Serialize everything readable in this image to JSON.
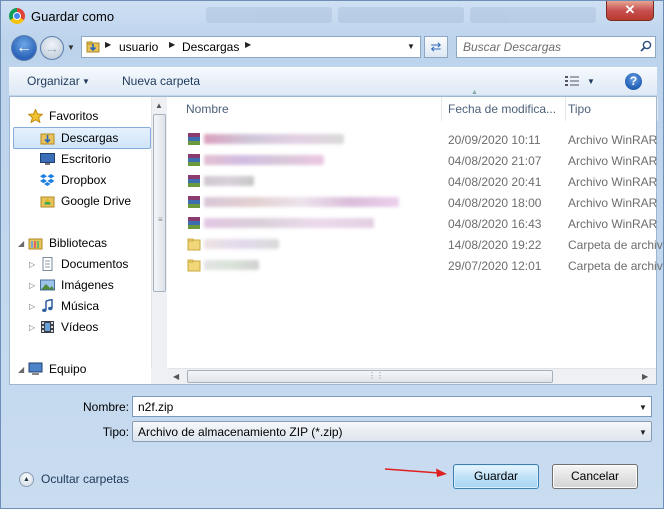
{
  "window": {
    "title": "Guardar como",
    "close_glyph": "✕"
  },
  "address_bar": {
    "crumbs": [
      "usuario",
      "Descargas"
    ],
    "search_placeholder": "Buscar Descargas"
  },
  "toolbar": {
    "organize_label": "Organizar",
    "new_folder_label": "Nueva carpeta",
    "help_glyph": "?"
  },
  "nav_pane": {
    "favorites": {
      "header": "Favoritos",
      "items": [
        {
          "label": "Descargas",
          "icon": "downloads-folder-icon",
          "selected": true
        },
        {
          "label": "Escritorio",
          "icon": "desktop-icon"
        },
        {
          "label": "Dropbox",
          "icon": "dropbox-icon"
        },
        {
          "label": "Google Drive",
          "icon": "google-drive-icon"
        }
      ]
    },
    "libraries": {
      "header": "Bibliotecas",
      "items": [
        {
          "label": "Documentos",
          "icon": "documents-icon"
        },
        {
          "label": "Imágenes",
          "icon": "pictures-icon"
        },
        {
          "label": "Música",
          "icon": "music-icon"
        },
        {
          "label": "Vídeos",
          "icon": "videos-icon"
        }
      ]
    },
    "computer": {
      "header": "Equipo"
    }
  },
  "file_list": {
    "columns": [
      "Nombre",
      "Fecha de modifica...",
      "Tipo"
    ],
    "rows": [
      {
        "name_redacted": true,
        "date": "20/09/2020 10:11",
        "type": "Archivo WinRAR",
        "icon": "winrar-archive-icon"
      },
      {
        "name_redacted": true,
        "date": "04/08/2020 21:07",
        "type": "Archivo WinRAR",
        "icon": "winrar-archive-icon"
      },
      {
        "name_redacted": true,
        "date": "04/08/2020 20:41",
        "type": "Archivo WinRAR",
        "icon": "winrar-archive-icon"
      },
      {
        "name_redacted": true,
        "date": "04/08/2020 18:00",
        "type": "Archivo WinRAR",
        "icon": "winrar-archive-icon"
      },
      {
        "name_redacted": true,
        "date": "04/08/2020 16:43",
        "type": "Archivo WinRAR",
        "icon": "winrar-archive-icon"
      },
      {
        "name_redacted": true,
        "date": "14/08/2020 19:22",
        "type": "Carpeta de archiv",
        "icon": "folder-icon"
      },
      {
        "name_redacted": true,
        "date": "29/07/2020 12:01",
        "type": "Carpeta de archiv",
        "icon": "folder-icon"
      }
    ]
  },
  "form": {
    "name_label": "Nombre:",
    "name_value": "n2f.zip",
    "type_label": "Tipo:",
    "type_value": "Archivo de almacenamiento ZIP (*.zip)"
  },
  "footer": {
    "hide_folders_label": "Ocultar carpetas",
    "save_label": "Guardar",
    "cancel_label": "Cancelar"
  },
  "colors": {
    "annotation_arrow": "#e02020",
    "accent": "#3c7fb1"
  }
}
